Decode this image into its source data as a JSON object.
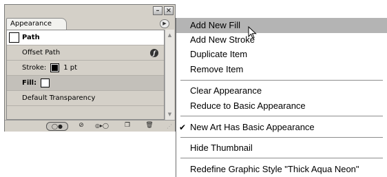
{
  "panel": {
    "tab_label": "Appearance",
    "rows": [
      {
        "label": "Path"
      },
      {
        "label": "Offset Path"
      },
      {
        "label": "Stroke:",
        "value": "1 pt"
      },
      {
        "label": "Fill:"
      },
      {
        "label": "Default Transparency"
      }
    ]
  },
  "menu": {
    "items": [
      {
        "label": "Add New Fill"
      },
      {
        "label": "Add New Stroke"
      },
      {
        "label": "Duplicate Item"
      },
      {
        "label": "Remove Item"
      },
      {
        "label": "Clear Appearance"
      },
      {
        "label": "Reduce to Basic Appearance"
      },
      {
        "label": "New Art Has Basic Appearance",
        "checked": true
      },
      {
        "label": "Hide Thumbnail"
      },
      {
        "label": "Redefine Graphic Style \"Thick Aqua Neon\""
      }
    ]
  },
  "colors": {
    "highlight": "#b4b4b4",
    "panel_bg": "#d4d0c8"
  }
}
